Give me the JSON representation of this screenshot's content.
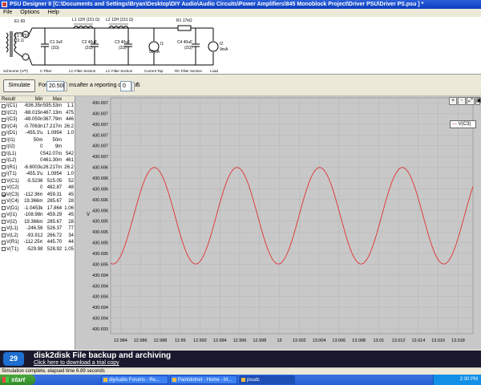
{
  "window": {
    "title": "PSU Designer II  [C:\\Documents and Settings\\Bryan\\Desktop\\DIY Audio\\Audio Circuits\\Power Amplifiers\\845 Monoblock Project\\Driver PSU\\Driver PS.psu ] *"
  },
  "menu": [
    "File",
    "Options",
    "Help"
  ],
  "schematic": {
    "transformer": {
      "top": "E1 69",
      "name": "T1 375V",
      "sub": "31 Ω",
      "label": "Schnorrer (V/T)"
    },
    "c1": {
      "name": "C1 3uF",
      "sub": "(2Ω)"
    },
    "l1": {
      "name": "L1 12H (151 Ω)"
    },
    "c2": {
      "name": "C2 40uF",
      "sub": "(2Ω)"
    },
    "l2": {
      "name": "L2 12H (151 Ω)"
    },
    "c3": {
      "name": "C3 40uF",
      "sub": "(2Ω)"
    },
    "i1": {
      "name": "I1",
      "sub": "50mA"
    },
    "r1": {
      "name": "R1 17kΩ"
    },
    "c4": {
      "name": "C4 40uF",
      "sub": "(2Ω)"
    },
    "i2": {
      "name": "I2",
      "sub": "9mA"
    },
    "sections": [
      "C Filter",
      "LC Filter Section",
      "LC Filter Section",
      "Current Tap",
      "RC Filter Section",
      "Load"
    ]
  },
  "simbar": {
    "simulate": "Simulate",
    "for_label": "For",
    "duration": "20.500",
    "unit_ms": "ms",
    "delay_label": "after a reporting delay of",
    "delay": "0",
    "unit_s": "S"
  },
  "results": {
    "headers": [
      "Result",
      "Min",
      "Max",
      ""
    ],
    "rows": [
      {
        "name": "I(C1)",
        "min": "-636.35m",
        "max": "595.53m",
        "extra": "1.1",
        "checked": false
      },
      {
        "name": "I(C2)",
        "min": "-68.015m",
        "max": "467.13m",
        "extra": "475",
        "checked": false
      },
      {
        "name": "I(C3)",
        "min": "-48.050m",
        "max": "367.79m",
        "extra": "446",
        "checked": false
      },
      {
        "name": "I(C4)",
        "min": "-0.7063m",
        "max": "17.217m",
        "extra": "26.2",
        "checked": false
      },
      {
        "name": "I(D1)",
        "min": "-455.3'u",
        "max": "1.0954",
        "extra": "1.0",
        "checked": false
      },
      {
        "name": "I(I1)",
        "min": "50m",
        "max": "50m",
        "extra": "",
        "checked": false
      },
      {
        "name": "I(I2)",
        "min": "0",
        "max": "9m",
        "extra": "",
        "checked": false
      },
      {
        "name": "I(L1)",
        "min": "0",
        "max": "542.07m",
        "extra": "542",
        "checked": false
      },
      {
        "name": "I(L2)",
        "min": "0",
        "max": "461.30m",
        "extra": "461",
        "checked": false
      },
      {
        "name": "I(R1)",
        "min": "-6.6003u",
        "max": "26.217m",
        "extra": "26.2",
        "checked": false
      },
      {
        "name": "I(T1)",
        "min": "-455.3'u",
        "max": "1.0954",
        "extra": "1.0",
        "checked": false
      },
      {
        "name": "V(C1)",
        "min": "-5.5236",
        "max": "515.05",
        "extra": "52",
        "checked": false
      },
      {
        "name": "V(C2)",
        "min": "0",
        "max": "482.87",
        "extra": "48",
        "checked": false
      },
      {
        "name": "V(C3)",
        "min": "-112.36m",
        "max": "459.31",
        "extra": "45",
        "checked": true
      },
      {
        "name": "V(C4)",
        "min": "19.366m",
        "max": "285.67",
        "extra": "28",
        "checked": false
      },
      {
        "name": "V(D1)",
        "min": "-1.0453k",
        "max": "17.864",
        "extra": "1.06",
        "checked": false
      },
      {
        "name": "V(I1)",
        "min": "-108.98m",
        "max": "459.29",
        "extra": "45",
        "checked": false
      },
      {
        "name": "V(I2)",
        "min": "19.366m",
        "max": "285.67",
        "extra": "28",
        "checked": false
      },
      {
        "name": "V(L1)",
        "min": "-246.56",
        "max": "526.37",
        "extra": "77",
        "checked": false
      },
      {
        "name": "V(L2)",
        "min": "-93.912",
        "max": "266.72",
        "extra": "34",
        "checked": false
      },
      {
        "name": "V(R1)",
        "min": "-112.25m",
        "max": "445.70",
        "extra": "44",
        "checked": false
      },
      {
        "name": "V(T1)",
        "min": "-529.98",
        "max": "528.92",
        "extra": "1.05",
        "checked": false
      }
    ]
  },
  "zoom": [
    "+",
    "-",
    "⤢",
    "▣"
  ],
  "legend": "V(C3)",
  "chart_data": {
    "type": "line",
    "series": [
      {
        "name": "V(C3)",
        "color": "#e03030",
        "model": "sine"
      }
    ],
    "ylabel": "V",
    "yticks": [
      "430.697",
      "430.697",
      "430.697",
      "430.697",
      "430.697",
      "430.697",
      "430.696",
      "430.696",
      "430.696",
      "430.696",
      "430.696",
      "430.695",
      "430.695",
      "430.695",
      "430.695",
      "430.695",
      "430.694",
      "430.694",
      "430.694",
      "430.694",
      "430.694",
      "430.693"
    ],
    "xticks": [
      "12.984",
      "12.986",
      "12.988",
      "12.99",
      "12.992",
      "12.994",
      "12.996",
      "12.998",
      "13",
      "13.002",
      "13.004",
      "13.006",
      "13.008",
      "13.01",
      "13.012",
      "13.014",
      "13.016",
      "13.018"
    ],
    "xlim": [
      12.983,
      13.0195
    ],
    "wave": {
      "center": 430.6955,
      "amplitude": 0.0009,
      "period": 0.00833,
      "peak_at": 12.9874,
      "ylim": [
        430.6933,
        430.6977
      ]
    },
    "grid": true,
    "background": "#c8c8c8"
  },
  "banner": {
    "logo": "29",
    "headline": "disk2disk File backup and archiving",
    "link": "Click here to download a trial copy"
  },
  "status": "Simulation complete, elapsed time 6.89 seconds",
  "taskbar": {
    "start": "start",
    "tasks": [
      "diyAudio Forums - Re...",
      "Paintdotnet - Home - M...",
      "psudc"
    ],
    "active_task": 2,
    "clock": "2:30 PM"
  }
}
